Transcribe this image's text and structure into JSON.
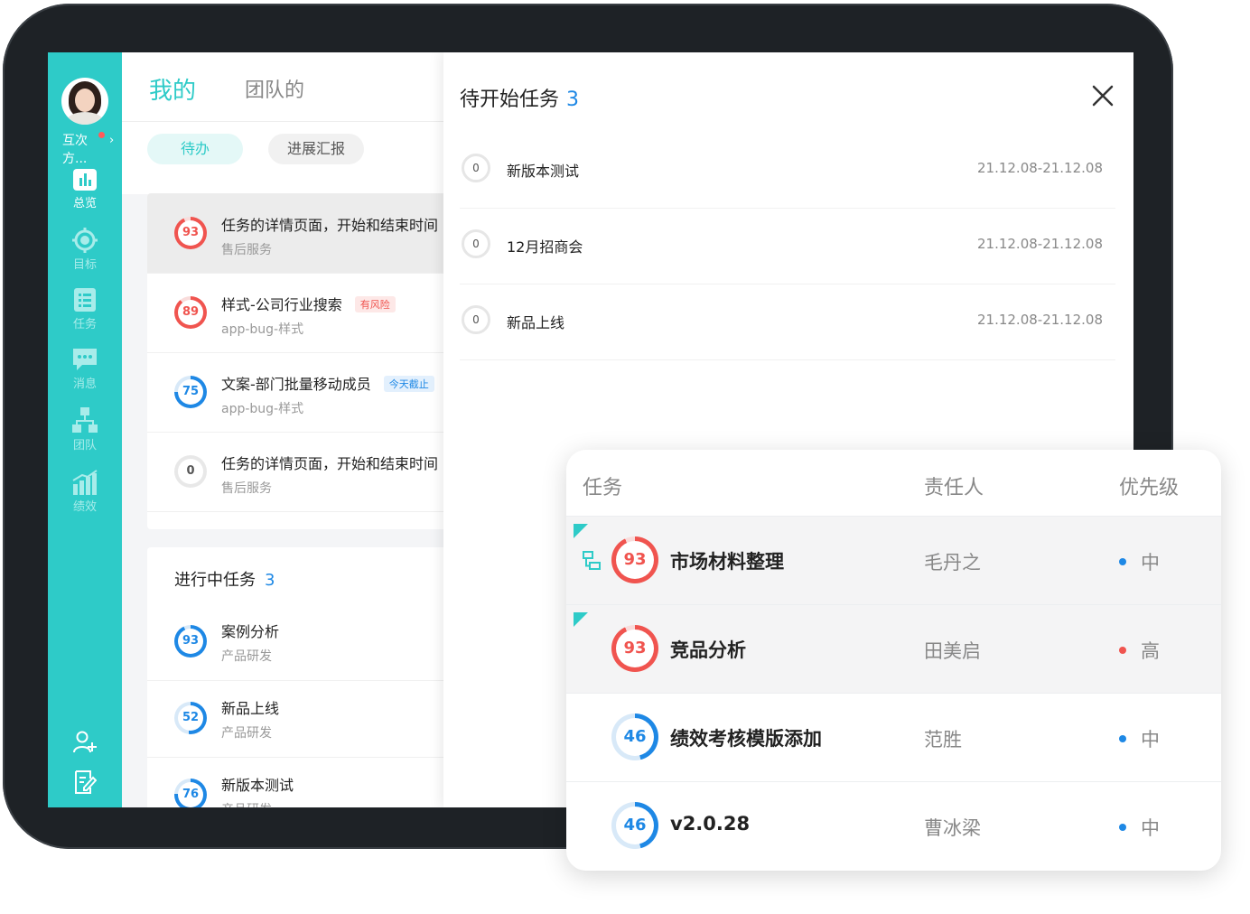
{
  "sidebar": {
    "user_name": "互次方...",
    "items": [
      {
        "label": "总览",
        "icon": "bar-chart-icon",
        "active": true
      },
      {
        "label": "目标",
        "icon": "target-icon",
        "active": false
      },
      {
        "label": "任务",
        "icon": "task-list-icon",
        "active": false
      },
      {
        "label": "消息",
        "icon": "message-icon",
        "active": false
      },
      {
        "label": "团队",
        "icon": "team-icon",
        "active": false
      },
      {
        "label": "绩效",
        "icon": "performance-icon",
        "active": false
      }
    ],
    "bottom_icons": [
      "add-user-icon",
      "edit-note-icon"
    ]
  },
  "header": {
    "tab_mine": "我的",
    "tab_team": "团队的"
  },
  "filters": {
    "todo": "待办",
    "progress_report": "进展汇报"
  },
  "todo_list": [
    {
      "score": "93",
      "score_pct": 93,
      "title": "任务的详情页面，开始和结束时间",
      "sub": "售后服务",
      "tag": "",
      "color": "#f0544f"
    },
    {
      "score": "89",
      "score_pct": 89,
      "title": "样式-公司行业搜索",
      "sub": "app-bug-样式",
      "tag": "有风险",
      "tag_type": "risk",
      "color": "#f0544f"
    },
    {
      "score": "75",
      "score_pct": 75,
      "title": "文案-部门批量移动成员",
      "sub": "app-bug-样式",
      "tag": "今天截止",
      "tag_type": "due",
      "color": "#1e88e5"
    },
    {
      "score": "0",
      "score_pct": 0,
      "title": "任务的详情页面，开始和结束时间",
      "sub": "售后服务",
      "tag": "",
      "color": "#cccccc"
    }
  ],
  "in_progress": {
    "title": "进行中任务",
    "count": "3",
    "items": [
      {
        "score": "93",
        "score_pct": 93,
        "title": "案例分析",
        "sub": "产品研发"
      },
      {
        "score": "52",
        "score_pct": 52,
        "title": "新品上线",
        "sub": "产品研发"
      },
      {
        "score": "76",
        "score_pct": 76,
        "title": "新版本测试",
        "sub": "产品研发"
      }
    ]
  },
  "modal": {
    "title": "待开始任务",
    "count": "3",
    "items": [
      {
        "score": "0",
        "name": "新版本测试",
        "date": "21.12.08-21.12.08"
      },
      {
        "score": "0",
        "name": "12月招商会",
        "date": "21.12.08-21.12.08"
      },
      {
        "score": "0",
        "name": "新品上线",
        "date": "21.12.08-21.12.08"
      }
    ]
  },
  "task_table": {
    "headers": {
      "task": "任务",
      "owner": "责任人",
      "priority": "优先级"
    },
    "rows": [
      {
        "score": "93",
        "score_pct": 93,
        "name": "市场材料整理",
        "owner": "毛丹之",
        "priority": "中",
        "priority_color": "#1e88e5",
        "ring_color": "#f0544f",
        "highlight": true,
        "subtask": true
      },
      {
        "score": "93",
        "score_pct": 93,
        "name": "竞品分析",
        "owner": "田美启",
        "priority": "高",
        "priority_color": "#f0544f",
        "ring_color": "#f0544f",
        "highlight": true,
        "subtask": false
      },
      {
        "score": "46",
        "score_pct": 46,
        "name": "绩效考核模版添加",
        "owner": "范胜",
        "priority": "中",
        "priority_color": "#1e88e5",
        "ring_color": "#1e88e5",
        "highlight": false,
        "subtask": false
      },
      {
        "score": "46",
        "score_pct": 46,
        "name": "v2.0.28",
        "owner": "曹冰梁",
        "priority": "中",
        "priority_color": "#1e88e5",
        "ring_color": "#1e88e5",
        "highlight": false,
        "subtask": false
      }
    ]
  },
  "colors": {
    "accent": "#2ecbc8",
    "blue": "#1e88e5",
    "red": "#f0544f"
  }
}
